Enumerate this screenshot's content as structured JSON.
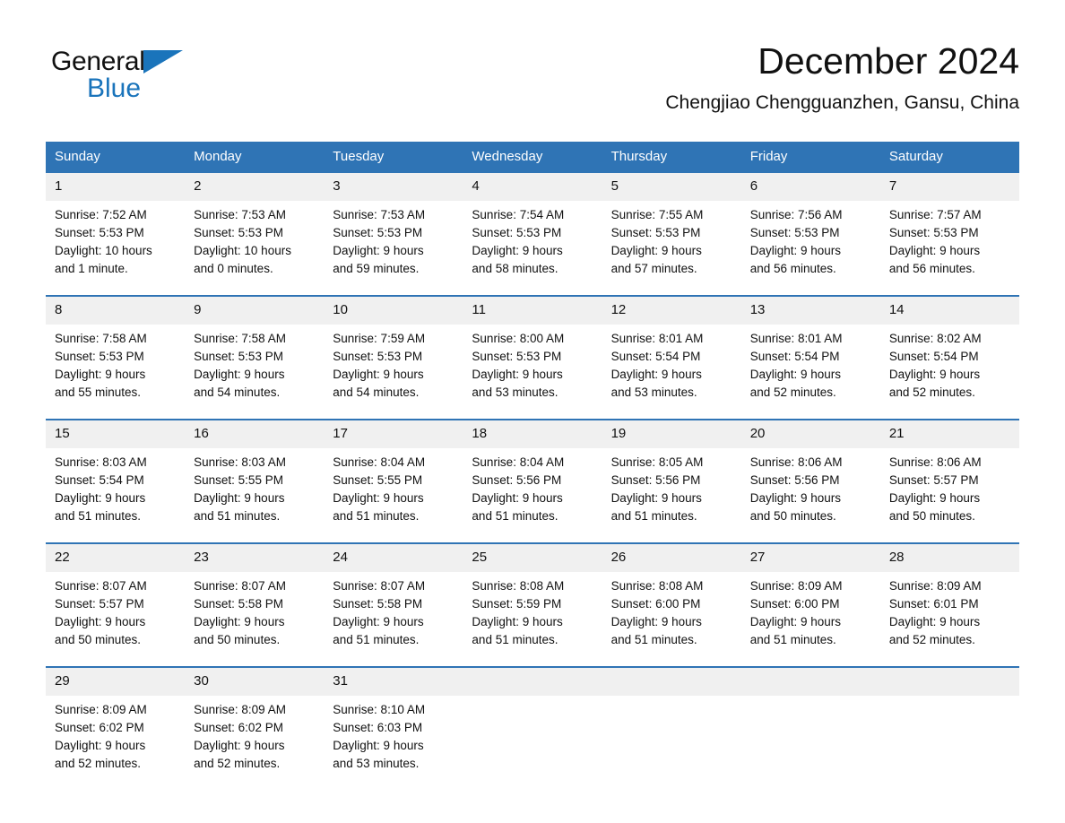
{
  "brand": {
    "name_part1": "General",
    "name_part2": "Blue",
    "color_dark": "#111111",
    "color_blue": "#1a74bb"
  },
  "header": {
    "title": "December 2024",
    "subtitle": "Chengjiao Chengguanzhen, Gansu, China"
  },
  "theme": {
    "header_blue": "#2f74b5",
    "day_number_bg": "#f0f0f0",
    "row_divider": "#2f74b5"
  },
  "weekdays": [
    "Sunday",
    "Monday",
    "Tuesday",
    "Wednesday",
    "Thursday",
    "Friday",
    "Saturday"
  ],
  "weeks": [
    [
      {
        "day": "1",
        "sunrise": "Sunrise: 7:52 AM",
        "sunset": "Sunset: 5:53 PM",
        "daylight1": "Daylight: 10 hours",
        "daylight2": "and 1 minute."
      },
      {
        "day": "2",
        "sunrise": "Sunrise: 7:53 AM",
        "sunset": "Sunset: 5:53 PM",
        "daylight1": "Daylight: 10 hours",
        "daylight2": "and 0 minutes."
      },
      {
        "day": "3",
        "sunrise": "Sunrise: 7:53 AM",
        "sunset": "Sunset: 5:53 PM",
        "daylight1": "Daylight: 9 hours",
        "daylight2": "and 59 minutes."
      },
      {
        "day": "4",
        "sunrise": "Sunrise: 7:54 AM",
        "sunset": "Sunset: 5:53 PM",
        "daylight1": "Daylight: 9 hours",
        "daylight2": "and 58 minutes."
      },
      {
        "day": "5",
        "sunrise": "Sunrise: 7:55 AM",
        "sunset": "Sunset: 5:53 PM",
        "daylight1": "Daylight: 9 hours",
        "daylight2": "and 57 minutes."
      },
      {
        "day": "6",
        "sunrise": "Sunrise: 7:56 AM",
        "sunset": "Sunset: 5:53 PM",
        "daylight1": "Daylight: 9 hours",
        "daylight2": "and 56 minutes."
      },
      {
        "day": "7",
        "sunrise": "Sunrise: 7:57 AM",
        "sunset": "Sunset: 5:53 PM",
        "daylight1": "Daylight: 9 hours",
        "daylight2": "and 56 minutes."
      }
    ],
    [
      {
        "day": "8",
        "sunrise": "Sunrise: 7:58 AM",
        "sunset": "Sunset: 5:53 PM",
        "daylight1": "Daylight: 9 hours",
        "daylight2": "and 55 minutes."
      },
      {
        "day": "9",
        "sunrise": "Sunrise: 7:58 AM",
        "sunset": "Sunset: 5:53 PM",
        "daylight1": "Daylight: 9 hours",
        "daylight2": "and 54 minutes."
      },
      {
        "day": "10",
        "sunrise": "Sunrise: 7:59 AM",
        "sunset": "Sunset: 5:53 PM",
        "daylight1": "Daylight: 9 hours",
        "daylight2": "and 54 minutes."
      },
      {
        "day": "11",
        "sunrise": "Sunrise: 8:00 AM",
        "sunset": "Sunset: 5:53 PM",
        "daylight1": "Daylight: 9 hours",
        "daylight2": "and 53 minutes."
      },
      {
        "day": "12",
        "sunrise": "Sunrise: 8:01 AM",
        "sunset": "Sunset: 5:54 PM",
        "daylight1": "Daylight: 9 hours",
        "daylight2": "and 53 minutes."
      },
      {
        "day": "13",
        "sunrise": "Sunrise: 8:01 AM",
        "sunset": "Sunset: 5:54 PM",
        "daylight1": "Daylight: 9 hours",
        "daylight2": "and 52 minutes."
      },
      {
        "day": "14",
        "sunrise": "Sunrise: 8:02 AM",
        "sunset": "Sunset: 5:54 PM",
        "daylight1": "Daylight: 9 hours",
        "daylight2": "and 52 minutes."
      }
    ],
    [
      {
        "day": "15",
        "sunrise": "Sunrise: 8:03 AM",
        "sunset": "Sunset: 5:54 PM",
        "daylight1": "Daylight: 9 hours",
        "daylight2": "and 51 minutes."
      },
      {
        "day": "16",
        "sunrise": "Sunrise: 8:03 AM",
        "sunset": "Sunset: 5:55 PM",
        "daylight1": "Daylight: 9 hours",
        "daylight2": "and 51 minutes."
      },
      {
        "day": "17",
        "sunrise": "Sunrise: 8:04 AM",
        "sunset": "Sunset: 5:55 PM",
        "daylight1": "Daylight: 9 hours",
        "daylight2": "and 51 minutes."
      },
      {
        "day": "18",
        "sunrise": "Sunrise: 8:04 AM",
        "sunset": "Sunset: 5:56 PM",
        "daylight1": "Daylight: 9 hours",
        "daylight2": "and 51 minutes."
      },
      {
        "day": "19",
        "sunrise": "Sunrise: 8:05 AM",
        "sunset": "Sunset: 5:56 PM",
        "daylight1": "Daylight: 9 hours",
        "daylight2": "and 51 minutes."
      },
      {
        "day": "20",
        "sunrise": "Sunrise: 8:06 AM",
        "sunset": "Sunset: 5:56 PM",
        "daylight1": "Daylight: 9 hours",
        "daylight2": "and 50 minutes."
      },
      {
        "day": "21",
        "sunrise": "Sunrise: 8:06 AM",
        "sunset": "Sunset: 5:57 PM",
        "daylight1": "Daylight: 9 hours",
        "daylight2": "and 50 minutes."
      }
    ],
    [
      {
        "day": "22",
        "sunrise": "Sunrise: 8:07 AM",
        "sunset": "Sunset: 5:57 PM",
        "daylight1": "Daylight: 9 hours",
        "daylight2": "and 50 minutes."
      },
      {
        "day": "23",
        "sunrise": "Sunrise: 8:07 AM",
        "sunset": "Sunset: 5:58 PM",
        "daylight1": "Daylight: 9 hours",
        "daylight2": "and 50 minutes."
      },
      {
        "day": "24",
        "sunrise": "Sunrise: 8:07 AM",
        "sunset": "Sunset: 5:58 PM",
        "daylight1": "Daylight: 9 hours",
        "daylight2": "and 51 minutes."
      },
      {
        "day": "25",
        "sunrise": "Sunrise: 8:08 AM",
        "sunset": "Sunset: 5:59 PM",
        "daylight1": "Daylight: 9 hours",
        "daylight2": "and 51 minutes."
      },
      {
        "day": "26",
        "sunrise": "Sunrise: 8:08 AM",
        "sunset": "Sunset: 6:00 PM",
        "daylight1": "Daylight: 9 hours",
        "daylight2": "and 51 minutes."
      },
      {
        "day": "27",
        "sunrise": "Sunrise: 8:09 AM",
        "sunset": "Sunset: 6:00 PM",
        "daylight1": "Daylight: 9 hours",
        "daylight2": "and 51 minutes."
      },
      {
        "day": "28",
        "sunrise": "Sunrise: 8:09 AM",
        "sunset": "Sunset: 6:01 PM",
        "daylight1": "Daylight: 9 hours",
        "daylight2": "and 52 minutes."
      }
    ],
    [
      {
        "day": "29",
        "sunrise": "Sunrise: 8:09 AM",
        "sunset": "Sunset: 6:02 PM",
        "daylight1": "Daylight: 9 hours",
        "daylight2": "and 52 minutes."
      },
      {
        "day": "30",
        "sunrise": "Sunrise: 8:09 AM",
        "sunset": "Sunset: 6:02 PM",
        "daylight1": "Daylight: 9 hours",
        "daylight2": "and 52 minutes."
      },
      {
        "day": "31",
        "sunrise": "Sunrise: 8:10 AM",
        "sunset": "Sunset: 6:03 PM",
        "daylight1": "Daylight: 9 hours",
        "daylight2": "and 53 minutes."
      },
      {
        "day": "",
        "sunrise": "",
        "sunset": "",
        "daylight1": "",
        "daylight2": ""
      },
      {
        "day": "",
        "sunrise": "",
        "sunset": "",
        "daylight1": "",
        "daylight2": ""
      },
      {
        "day": "",
        "sunrise": "",
        "sunset": "",
        "daylight1": "",
        "daylight2": ""
      },
      {
        "day": "",
        "sunrise": "",
        "sunset": "",
        "daylight1": "",
        "daylight2": ""
      }
    ]
  ]
}
